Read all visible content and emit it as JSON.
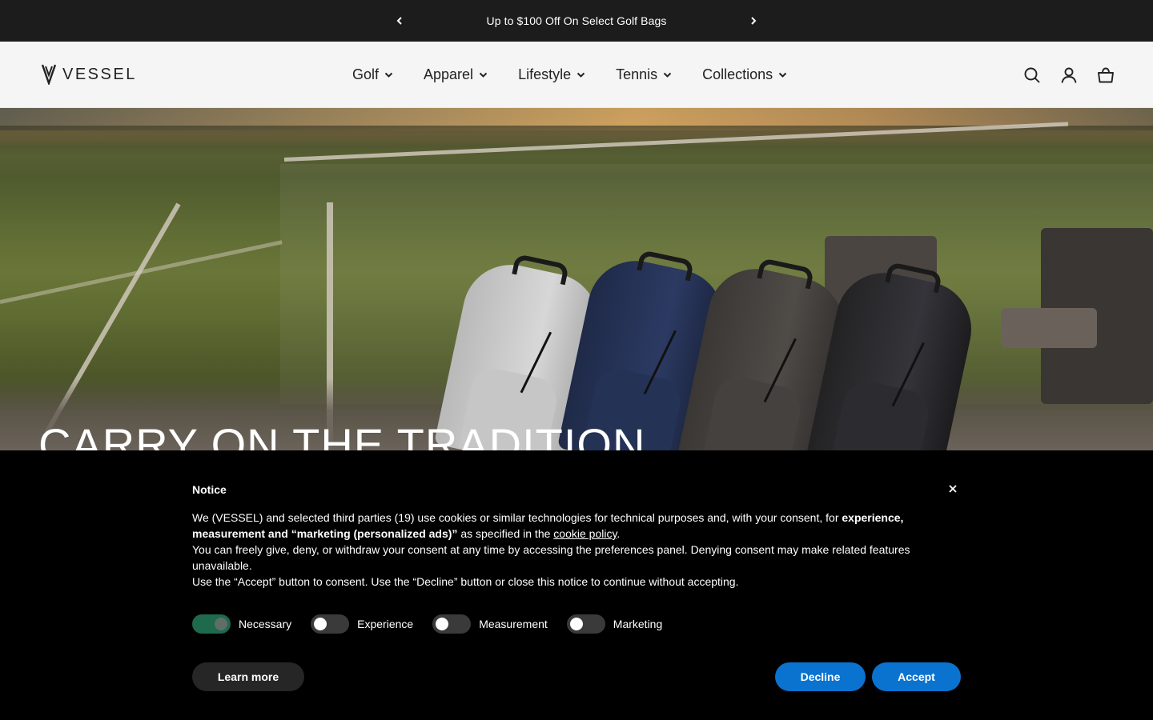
{
  "announcement": {
    "text": "Up to $100 Off On Select Golf Bags",
    "prev_icon": "chevron-left-icon",
    "next_icon": "chevron-right-icon"
  },
  "header": {
    "logo_text": "VESSEL",
    "nav": [
      {
        "label": "Golf"
      },
      {
        "label": "Apparel"
      },
      {
        "label": "Lifestyle"
      },
      {
        "label": "Tennis"
      },
      {
        "label": "Collections"
      }
    ],
    "icons": [
      "search-icon",
      "account-icon",
      "cart-icon"
    ]
  },
  "hero": {
    "title": "CARRY ON THE TRADITION"
  },
  "notice": {
    "title": "Notice",
    "body_p1_a": "We (VESSEL) and selected third parties (19) use cookies or similar technologies for technical purposes and, with your consent, for ",
    "body_p1_bold": "experience, measurement and “marketing (personalized ads)”",
    "body_p1_b": " as specified in the ",
    "body_p1_link": "cookie policy",
    "body_p1_c": ".",
    "body_p2": "You can freely give, deny, or withdraw your consent at any time by accessing the preferences panel. Denying consent may make related features unavailable.",
    "body_p3": "Use the “Accept” button to consent. Use the “Decline” button or close this notice to continue without accepting.",
    "toggles": [
      {
        "label": "Necessary",
        "on": true
      },
      {
        "label": "Experience",
        "on": false
      },
      {
        "label": "Measurement",
        "on": false
      },
      {
        "label": "Marketing",
        "on": false
      }
    ],
    "learn_more": "Learn more",
    "decline": "Decline",
    "accept": "Accept",
    "colors": {
      "primary_button": "#0a73d0",
      "toggle_on": "#1f6a4d"
    }
  }
}
